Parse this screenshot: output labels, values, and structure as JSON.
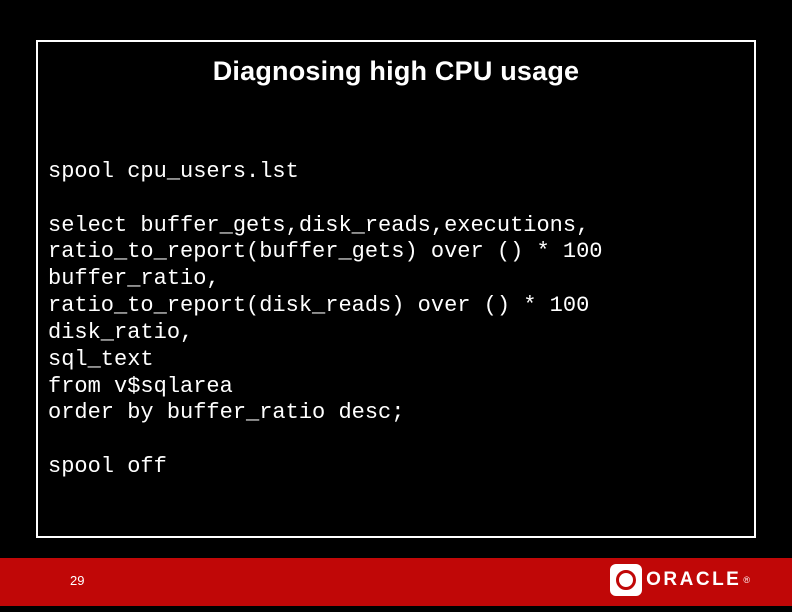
{
  "slide": {
    "title": "Diagnosing high CPU usage",
    "code": "spool cpu_users.lst\n\nselect buffer_gets,disk_reads,executions,\nratio_to_report(buffer_gets) over () * 100\nbuffer_ratio,\nratio_to_report(disk_reads) over () * 100\ndisk_ratio,\nsql_text\nfrom v$sqlarea\norder by buffer_ratio desc;\n\nspool off"
  },
  "footer": {
    "page_number": "29",
    "brand": "ORACLE",
    "registered": "®"
  }
}
